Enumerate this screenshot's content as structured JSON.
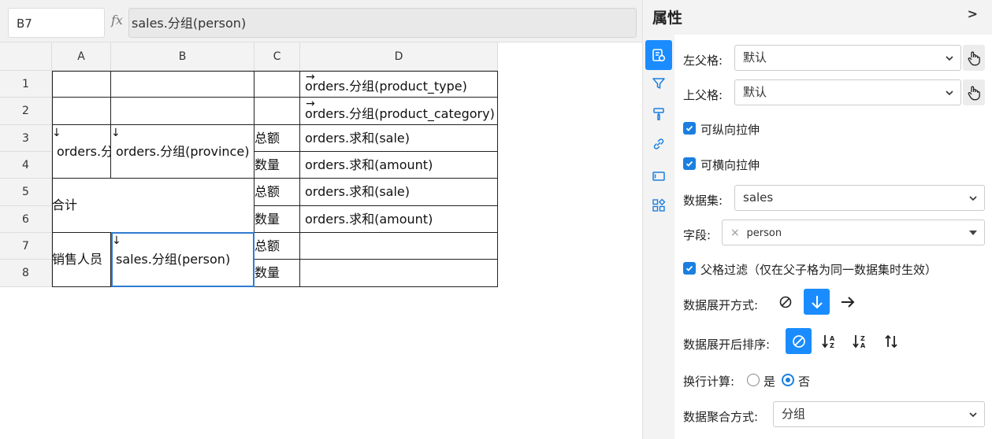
{
  "formula_bar": {
    "cell_ref": "B7",
    "fx": "fx",
    "formula": "sales.分组(person)"
  },
  "sheet": {
    "columns": [
      "A",
      "B",
      "C",
      "D"
    ],
    "rows": [
      "1",
      "2",
      "3",
      "4",
      "5",
      "6",
      "7",
      "8"
    ],
    "expand_down_arrow": "↓",
    "expand_right_arrow": "→",
    "cells": {
      "D1": "orders.分组(product_type)",
      "D2": "orders.分组(product_category)",
      "A3": "orders.分组(city)",
      "B3": "orders.分组(province)",
      "C3": "总额",
      "D3": "orders.求和(sale)",
      "C4": "数量",
      "D4": "orders.求和(amount)",
      "A5": "合计",
      "C5": "总额",
      "D5": "orders.求和(sale)",
      "C6": "数量",
      "D6": "orders.求和(amount)",
      "A7": "销售人员",
      "B7": "sales.分组(person)",
      "C7": "总额",
      "C8": "数量"
    }
  },
  "panel": {
    "title": "属性",
    "collapse": ">",
    "rail_icons": [
      "cell-settings-icon",
      "filter-icon",
      "format-brush-icon",
      "link-icon",
      "widget-icon",
      "components-icon"
    ],
    "left_parent": {
      "label": "左父格:",
      "value": "默认"
    },
    "top_parent": {
      "label": "上父格:",
      "value": "默认"
    },
    "vertical_stretch": {
      "label": "可纵向拉伸",
      "checked": true
    },
    "horizontal_stretch": {
      "label": "可横向拉伸",
      "checked": true
    },
    "dataset": {
      "label": "数据集:",
      "value": "sales"
    },
    "field": {
      "label": "字段:",
      "tag": "person",
      "tag_remove": "×"
    },
    "parent_filter": {
      "label": "父格过滤（仅在父子格为同一数据集时生效）",
      "checked": true
    },
    "expand_mode": {
      "label": "数据展开方式:",
      "selected": "down"
    },
    "sort": {
      "label": "数据展开后排序:",
      "selected": "none"
    },
    "line_calc": {
      "label": "换行计算:",
      "yes": "是",
      "no": "否",
      "selected": "no"
    },
    "aggregation": {
      "label": "数据聚合方式:",
      "value": "分组"
    },
    "colors": {
      "accent": "#1a8cff",
      "selection": "#2f7bd1"
    }
  }
}
